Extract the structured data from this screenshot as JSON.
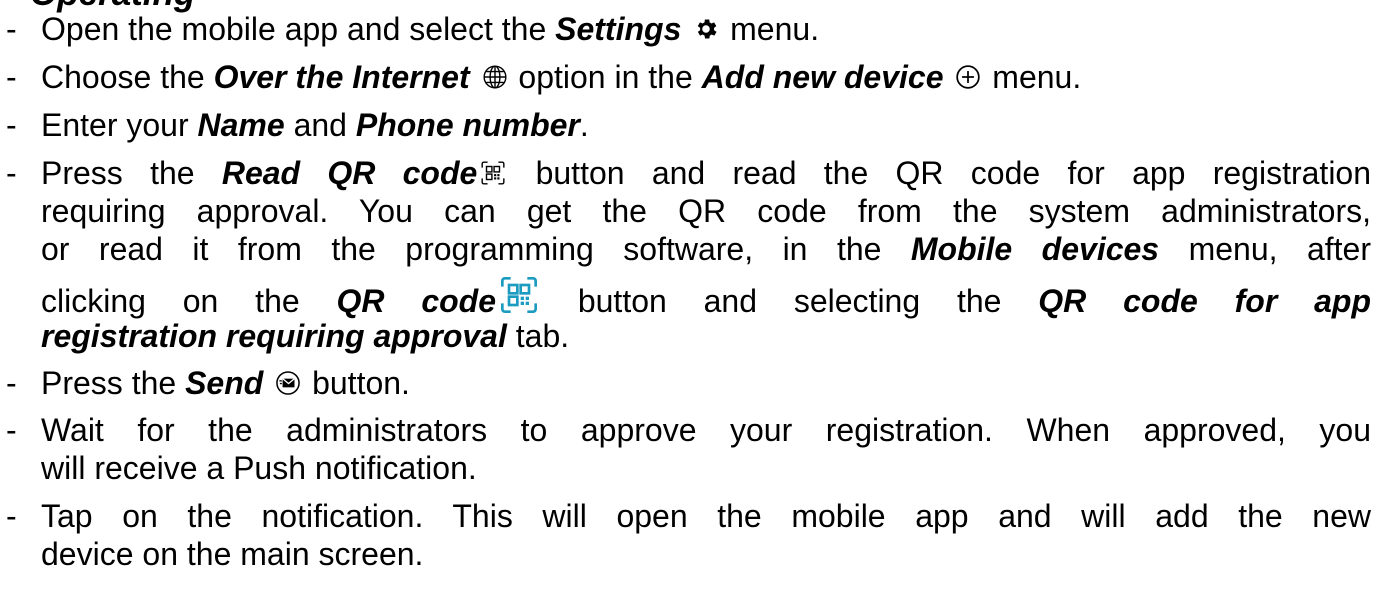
{
  "heading_partial": "Operating",
  "bullet": "-",
  "icons": {
    "settings": "gear-icon",
    "internet": "globe-icon",
    "add": "plus-circle-icon",
    "qr": "qr-code-icon",
    "qr_color": "qr-code-icon-teal",
    "send": "send-envelope-icon"
  },
  "colors": {
    "text": "#000000",
    "qr_accent": "#1a9bbf"
  },
  "step1": {
    "pre": "Open the mobile app and select the ",
    "settings": "Settings",
    "post": " menu."
  },
  "step2": {
    "pre": "Choose the ",
    "internet": "Over the Internet",
    "mid": " option in the ",
    "add_device": "Add new device",
    "post": " menu."
  },
  "step3": {
    "pre": "Enter your ",
    "name": "Name",
    "and": " and ",
    "phone": "Phone number",
    "post": "."
  },
  "step4": {
    "l1_pre": "Press the ",
    "read_qr": "Read QR code",
    "l1_post": " button and read the QR code for app registration",
    "l2": "requiring approval. You can get the QR code from the system administrators,",
    "l3_pre": "or read it from the programming software, in the ",
    "mobile_devices": "Mobile devices",
    "l3_post": " menu, after",
    "l4_pre": "clicking on the ",
    "qr_code": "QR code",
    "l4_mid": " button and selecting the ",
    "qr_tab_a": "QR code for app",
    "qr_tab_b": "registration requiring approval",
    "l5_post": " tab."
  },
  "step5": {
    "pre": "Press the ",
    "send": "Send",
    "post": " button."
  },
  "step6": {
    "l1": "Wait for the administrators to approve your registration. When approved, you",
    "l2": "will receive a Push notification."
  },
  "step7": {
    "l1": "Tap on the notification. This will open the mobile app and will add the new",
    "l2": "device on the main screen."
  }
}
